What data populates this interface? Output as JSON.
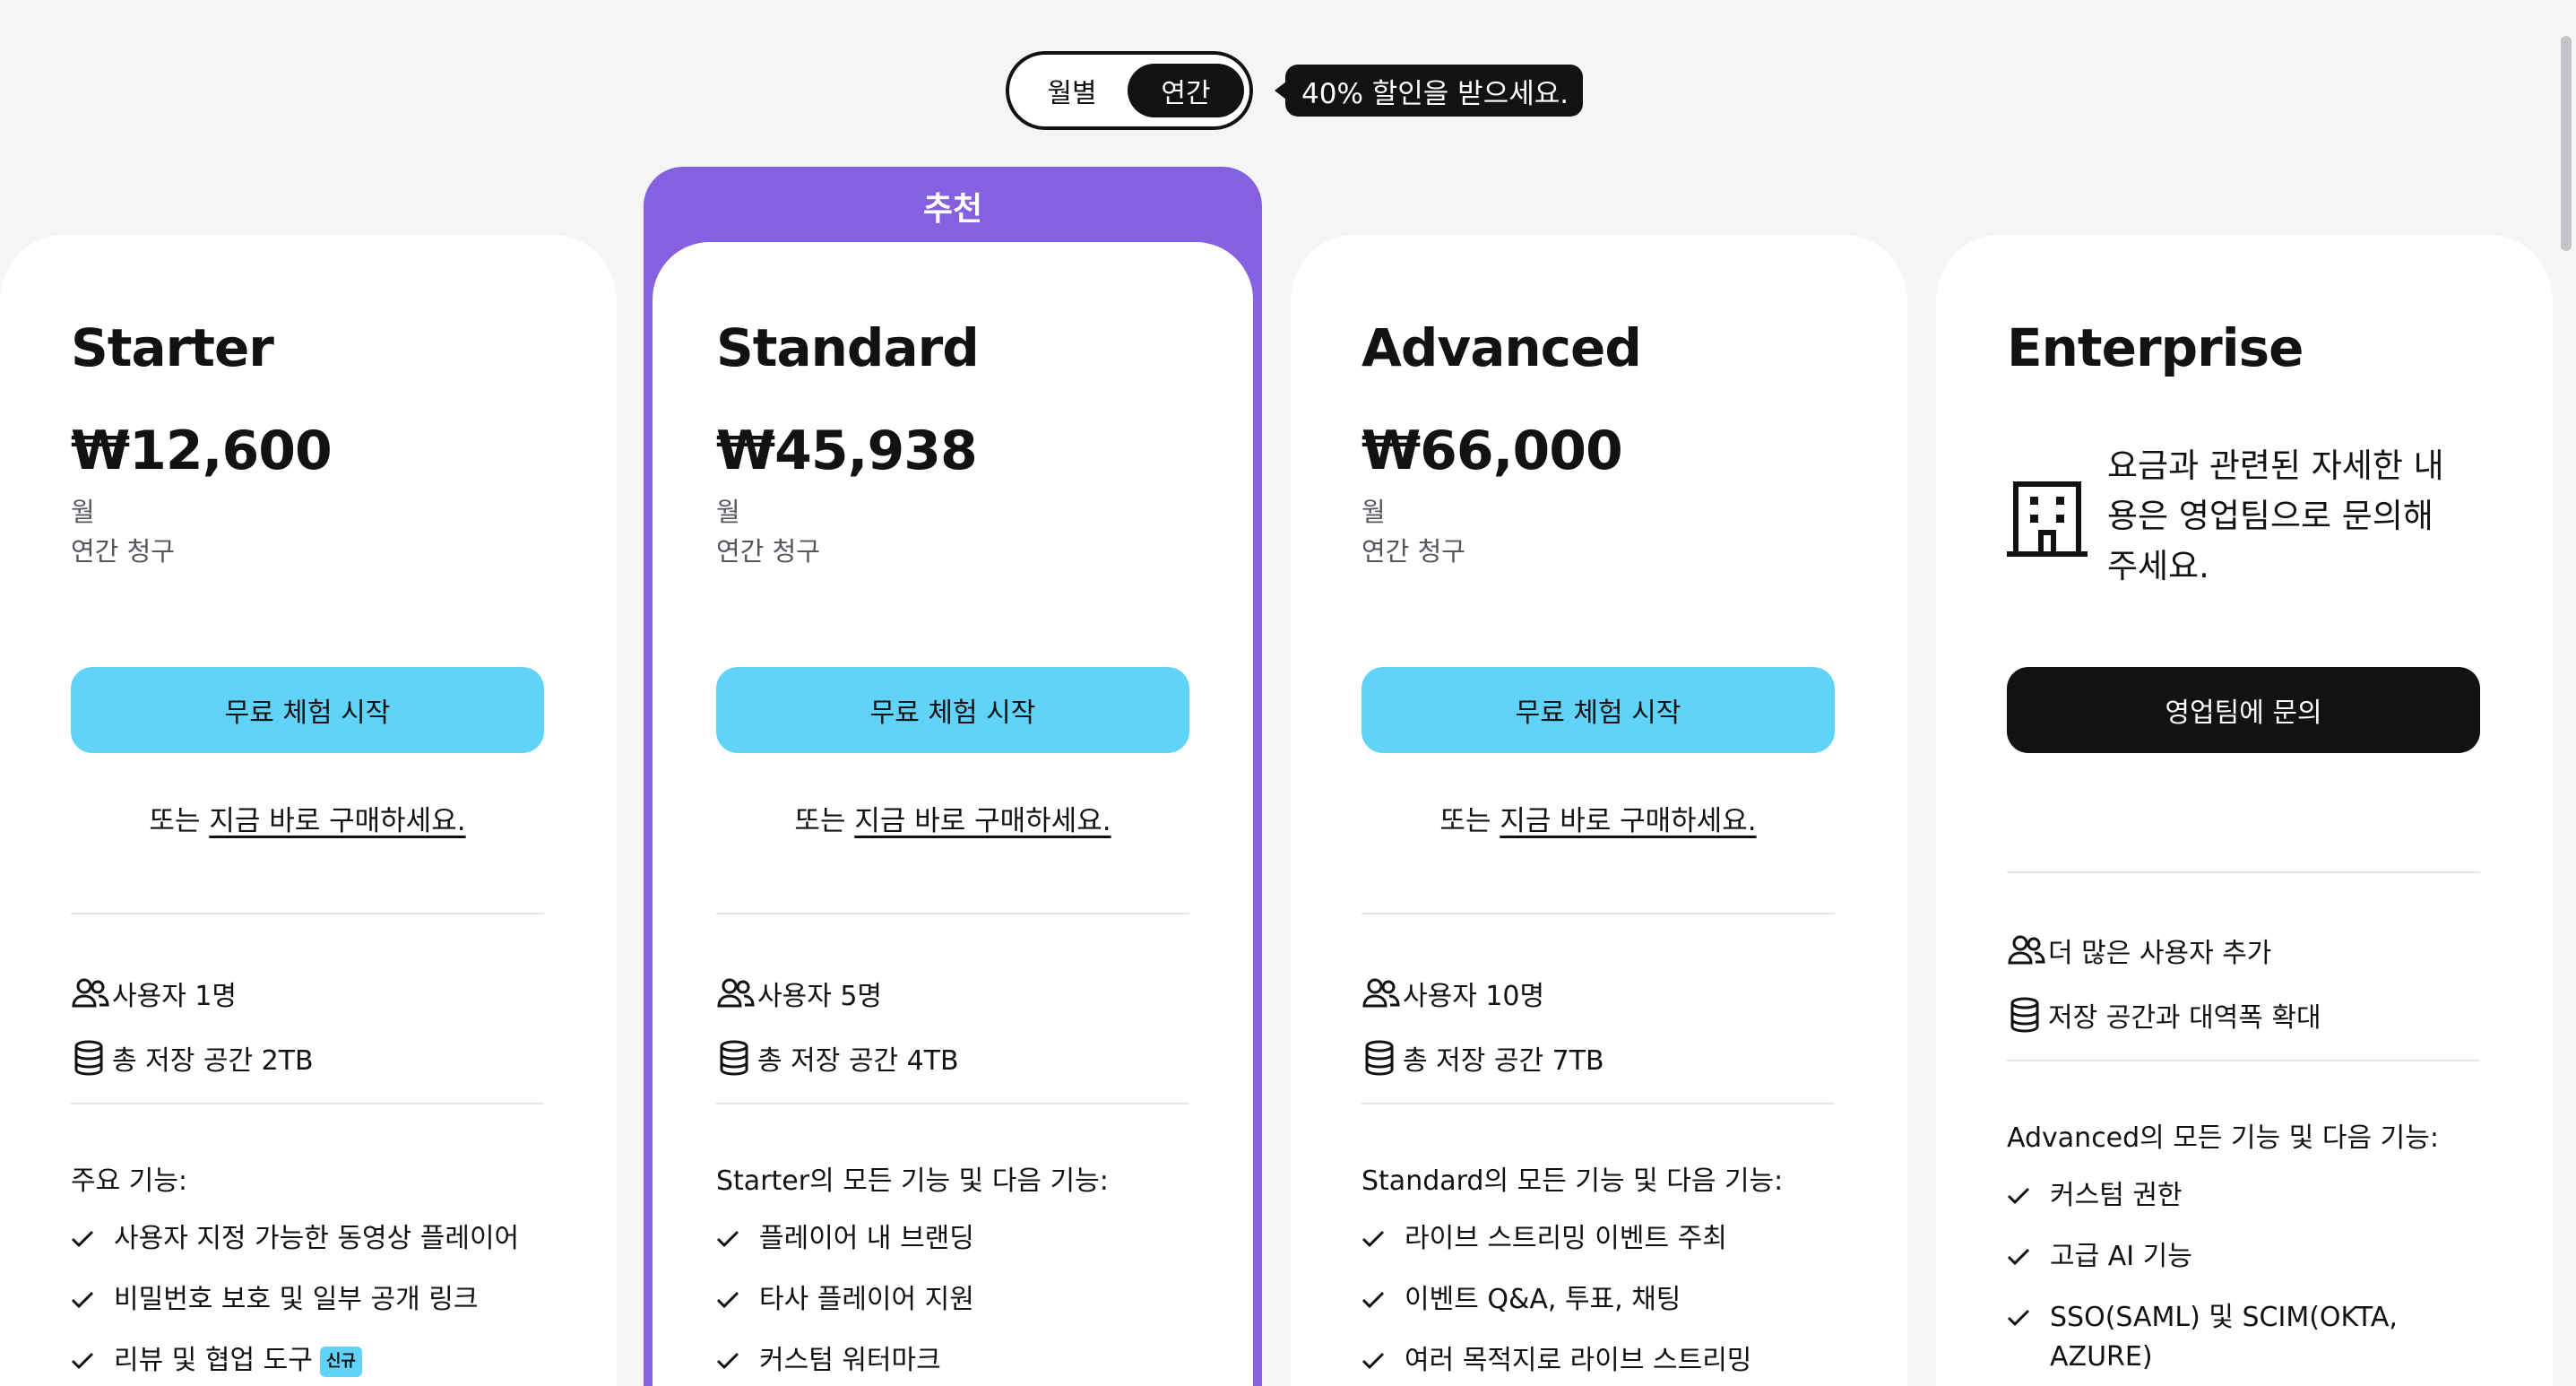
{
  "toggle": {
    "monthly": "월별",
    "annual": "연간",
    "selected": "annual"
  },
  "discount": "40% 할인을 받으세요.",
  "recommended_label": "추천",
  "plans": {
    "starter": {
      "name": "Starter",
      "price": "₩12,600",
      "per": "월",
      "billing": "연간 청구",
      "cta": "무료 체험 시작",
      "or_prefix": "또는 ",
      "or_link": "지금 바로 구매하세요.",
      "users": "사용자 1명",
      "storage": "총 저장 공간 2TB",
      "features_title": "주요 기능:",
      "features": [
        "사용자 지정 가능한 동영상 플레이어",
        "비밀번호 보호 및 일부 공개 링크",
        "리뷰 및 협업 도구"
      ],
      "new_badge": "신규"
    },
    "standard": {
      "name": "Standard",
      "price": "₩45,938",
      "per": "월",
      "billing": "연간 청구",
      "cta": "무료 체험 시작",
      "or_prefix": "또는 ",
      "or_link": "지금 바로 구매하세요.",
      "users": "사용자 5명",
      "storage": "총 저장 공간 4TB",
      "features_title": "Starter의 모든 기능 및 다음 기능:",
      "features": [
        "플레이어 내 브랜딩",
        "타사 플레이어 지원",
        "커스텀 워터마크"
      ]
    },
    "advanced": {
      "name": "Advanced",
      "price": "₩66,000",
      "per": "월",
      "billing": "연간 청구",
      "cta": "무료 체험 시작",
      "or_prefix": "또는 ",
      "or_link": "지금 바로 구매하세요.",
      "users": "사용자 10명",
      "storage": "총 저장 공간 7TB",
      "features_title": "Standard의 모든 기능 및 다음 기능:",
      "features": [
        "라이브 스트리밍 이벤트 주최",
        "이벤트 Q&A, 투표, 채팅",
        "여러 목적지로 라이브 스트리밍"
      ]
    },
    "enterprise": {
      "name": "Enterprise",
      "info": "요금과 관련된 자세한 내용은 영업팀으로 문의해 주세요.",
      "cta": "영업팀에 문의",
      "users": "더 많은 사용자 추가",
      "storage": "저장 공간과 대역폭 확대",
      "features_title": "Advanced의 모든 기능 및 다음 기능:",
      "features": [
        "커스텀 권한",
        "고급 AI 기능",
        "SSO(SAML) 및 SCIM(OKTA, AZURE)"
      ]
    }
  },
  "colors": {
    "accent_purple": "#8561e0",
    "cta_cyan": "#62d3f8",
    "dark": "#111214"
  }
}
